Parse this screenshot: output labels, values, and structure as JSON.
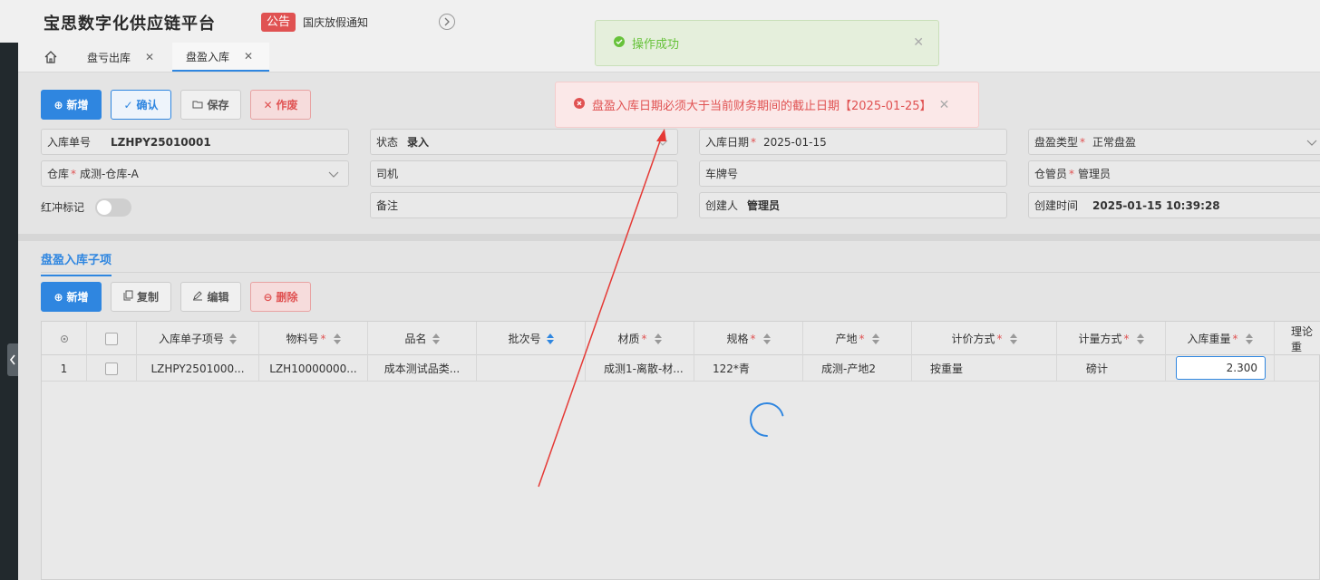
{
  "header": {
    "brand": "宝思数字化供应链平台",
    "notice_tag": "公告",
    "notice_text": "国庆放假通知"
  },
  "tabs": [
    {
      "label": "盘亏出库"
    },
    {
      "label": "盘盈入库"
    }
  ],
  "toolbar": {
    "add": "新增",
    "confirm": "确认",
    "save": "保存",
    "void": "作废"
  },
  "form": {
    "order_no_label": "入库单号",
    "order_no": "LZHPY25010001",
    "status_label": "状态",
    "status": "录入",
    "date_label": "入库日期",
    "date": "2025-01-15",
    "type_label": "盘盈类型",
    "type": "正常盘盈",
    "warehouse_label": "仓库",
    "warehouse": "成测-仓库-A",
    "driver_label": "司机",
    "plate_label": "车牌号",
    "keeper_label": "仓管员",
    "keeper": "管理员",
    "red_label": "红冲标记",
    "remark_label": "备注",
    "creator_label": "创建人",
    "creator": "管理员",
    "created_label": "创建时间",
    "created": "2025-01-15 10:39:28"
  },
  "subtab": "盘盈入库子项",
  "sub_toolbar": {
    "add": "新增",
    "copy": "复制",
    "edit": "编辑",
    "delete": "删除"
  },
  "table": {
    "columns": [
      "入库单子项号",
      "物料号",
      "品名",
      "批次号",
      "材质",
      "规格",
      "产地",
      "计价方式",
      "计量方式",
      "入库重量",
      "理论重"
    ],
    "rows": [
      {
        "index": "1",
        "sub_no": "LZHPY2501000...",
        "material_no": "LZH10000000...",
        "name": "成本测试品类...",
        "batch": "",
        "texture": "成测1-离散-材...",
        "spec": "122*青",
        "origin": "成测-产地2",
        "pricing": "按重量",
        "measure": "磅计",
        "weight": "2.300"
      }
    ]
  },
  "toasts": {
    "success": "操作成功",
    "error": "盘盈入库日期必须大于当前财务期间的截止日期【2025-01-25】"
  },
  "colors": {
    "primary": "#2f86e0",
    "danger": "#e05252",
    "success": "#67c23a"
  }
}
